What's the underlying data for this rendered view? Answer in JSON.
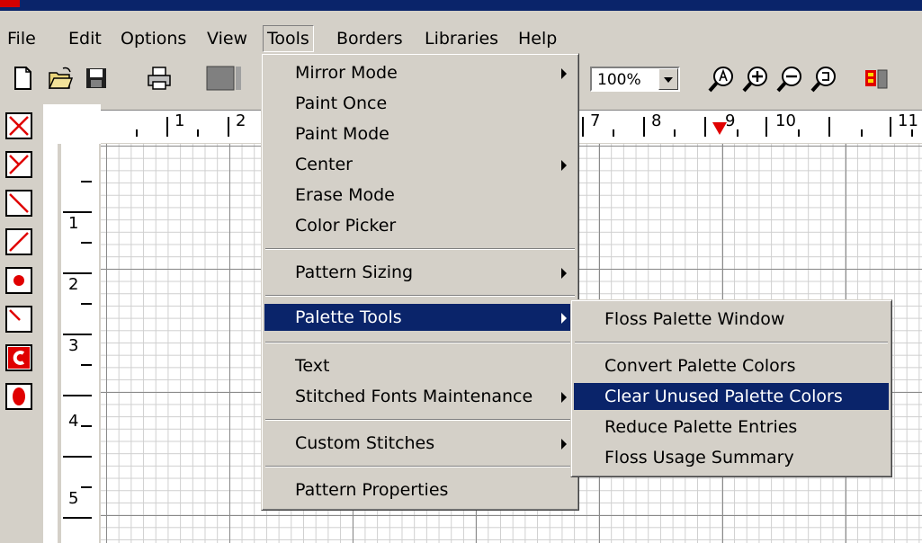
{
  "menubar": {
    "items": [
      {
        "label": "File"
      },
      {
        "label": "Edit"
      },
      {
        "label": "Options"
      },
      {
        "label": "View"
      },
      {
        "label": "Tools"
      },
      {
        "label": "Borders"
      },
      {
        "label": "Libraries"
      },
      {
        "label": "Help"
      }
    ]
  },
  "toolbar": {
    "zoom_value": "100%",
    "icons": [
      "new-file-icon",
      "open-folder-icon",
      "save-icon",
      "print-icon",
      "color-swatch-icon",
      "zoom-fit-icon",
      "zoom-in-icon",
      "zoom-out-icon",
      "zoom-restore-icon"
    ]
  },
  "ruler": {
    "horizontal_labels": [
      "1",
      "2",
      "7",
      "8",
      "9",
      "10",
      "11"
    ],
    "vertical_labels": [
      "1",
      "2",
      "3",
      "4",
      "5"
    ]
  },
  "tools_menu": {
    "items": [
      {
        "label": "Mirror Mode",
        "submenu": true
      },
      {
        "label": "Paint Once",
        "submenu": false
      },
      {
        "label": "Paint Mode",
        "submenu": false
      },
      {
        "label": "Center",
        "submenu": true
      },
      {
        "label": "Erase Mode",
        "submenu": false
      },
      {
        "label": "Color Picker",
        "submenu": false
      },
      {
        "label": "Pattern Sizing",
        "submenu": true
      },
      {
        "label": "Palette Tools",
        "submenu": true,
        "highlighted": true
      },
      {
        "label": "Text",
        "submenu": false
      },
      {
        "label": "Stitched Fonts Maintenance",
        "submenu": true
      },
      {
        "label": "Custom Stitches",
        "submenu": true
      },
      {
        "label": "Pattern Properties",
        "submenu": false
      }
    ]
  },
  "palette_submenu": {
    "items": [
      {
        "label": "Floss Palette Window"
      },
      {
        "label": "Convert Palette Colors"
      },
      {
        "label": "Clear Unused Palette Colors",
        "highlighted": true
      },
      {
        "label": "Reduce Palette Entries"
      },
      {
        "label": "Floss Usage Summary"
      }
    ]
  },
  "colors": {
    "menu_bg": "#d4d0c8",
    "highlight": "#0a246a",
    "stitch_red": "#e00000"
  }
}
